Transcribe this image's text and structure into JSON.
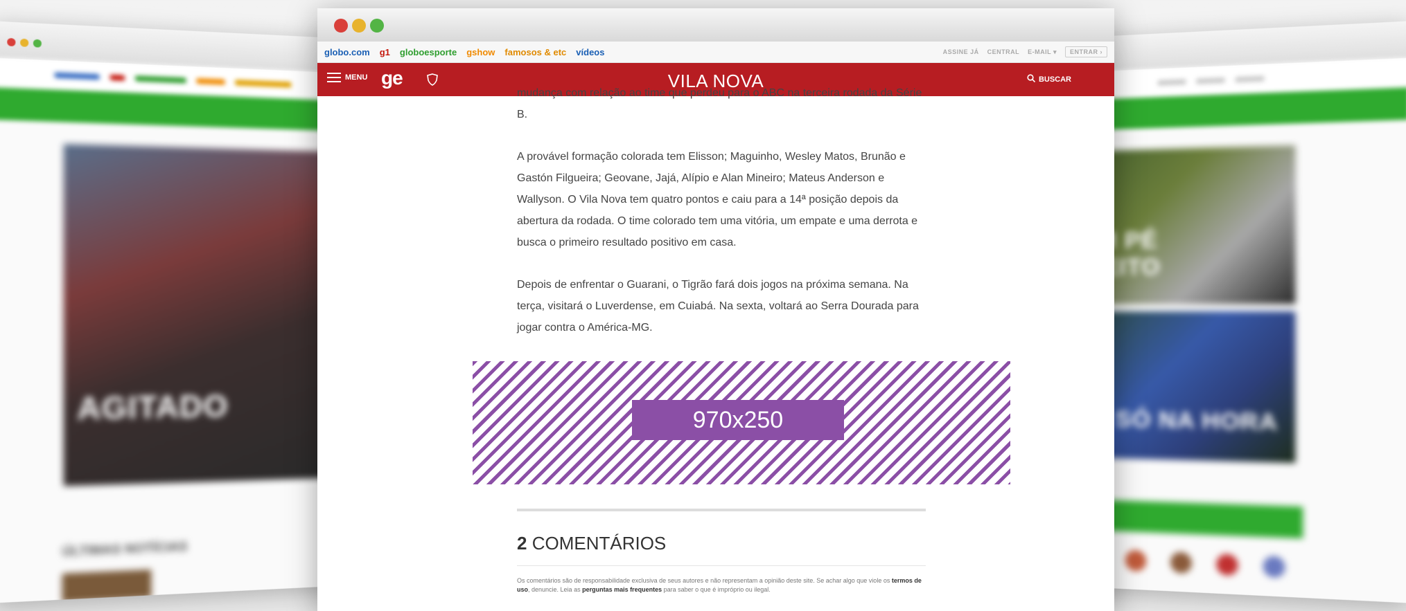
{
  "left_browser": {
    "headline": "AGITADO",
    "section_title": "ÚLTIMAS NOTÍCIAS"
  },
  "right_browser": {
    "headline_top": "COM PÉ DIREITO",
    "headline_bottom": "SÓ NA HORA"
  },
  "window": {
    "traffic_lights": [
      "#d9403a",
      "#e8b32d",
      "#53b445"
    ]
  },
  "globo_links": [
    {
      "label": "globo.com",
      "color": "#1a5fb4"
    },
    {
      "label": "g1",
      "color": "#c4170c"
    },
    {
      "label": "globoesporte",
      "color": "#2f9e2f"
    },
    {
      "label": "gshow",
      "color": "#f08a00"
    },
    {
      "label": "famosos & etc",
      "color": "#e08a00"
    },
    {
      "label": "vídeos",
      "color": "#1a5fb4"
    }
  ],
  "account_links": {
    "assine": "ASSINE JÁ",
    "central": "CENTRAL",
    "email": "E-MAIL",
    "entrar": "ENTRAR"
  },
  "header": {
    "menu_label": "MENU",
    "logo": "ge",
    "title": "VILA NOVA",
    "search_label": "BUSCAR",
    "color": "#b71d22"
  },
  "article": {
    "paragraphs": [
      "mudança com relação ao time que perdeu para o ABC na terceira rodada da Série B.",
      "A provável formação colorada tem Elisson; Maguinho, Wesley Matos, Brunão e Gastón Filgueira; Geovane, Jajá, Alípio e Alan Mineiro; Mateus Anderson e Wallyson. O Vila Nova tem quatro pontos e caiu para a 14ª posição depois da abertura da rodada. O time colorado tem uma vitória, um empate e uma derrota e busca o primeiro resultado positivo em casa.",
      "Depois de enfrentar o Guarani, o Tigrão fará dois jogos na próxima semana. Na terça, visitará o Luverdense, em Cuiabá. Na sexta, voltará ao Serra Dourada para jogar contra o América-MG."
    ]
  },
  "ad": {
    "size_label": "970x250",
    "color": "#8b4fa6"
  },
  "comments": {
    "count": "2",
    "label": "COMENTÁRIOS",
    "disclaimer_1": "Os comentários são de responsabilidade exclusiva de seus autores e não representam a opinião deste site. Se achar algo que viole os",
    "terms_link": "termos de uso",
    "disclaimer_2": ", denuncie. Leia as",
    "faq_link": "perguntas mais frequentes",
    "disclaimer_3": "para saber o que é impróprio ou ilegal."
  }
}
